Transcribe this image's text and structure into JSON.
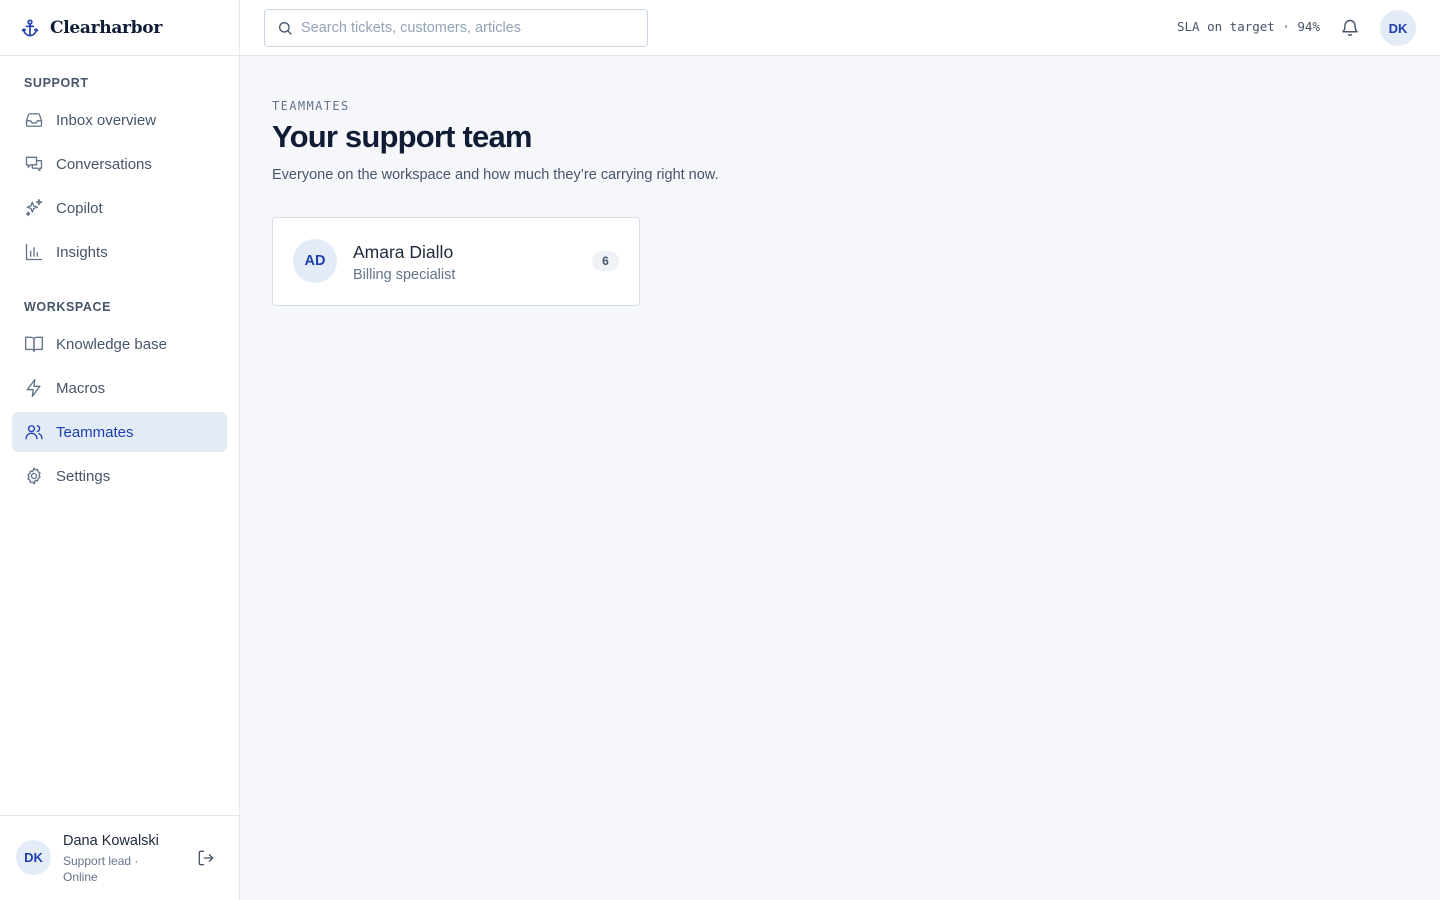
{
  "brand": {
    "name": "Clearharbor"
  },
  "sidebar": {
    "sections": [
      {
        "label": "SUPPORT"
      },
      {
        "label": "WORKSPACE"
      }
    ],
    "items": [
      {
        "label": "Inbox overview",
        "icon": "inbox-icon"
      },
      {
        "label": "Conversations",
        "icon": "chat-bubbles-icon"
      },
      {
        "label": "Copilot",
        "icon": "sparkles-icon"
      },
      {
        "label": "Insights",
        "icon": "bar-chart-icon"
      },
      {
        "label": "Knowledge base",
        "icon": "book-open-icon"
      },
      {
        "label": "Macros",
        "icon": "lightning-icon"
      },
      {
        "label": "Teammates",
        "icon": "users-icon",
        "active": true
      },
      {
        "label": "Settings",
        "icon": "gear-icon"
      }
    ],
    "user": {
      "initials": "DK",
      "name": "Dana Kowalski",
      "role": "Support lead · Online"
    }
  },
  "topbar": {
    "search": {
      "placeholder": "Search tickets, customers, articles",
      "value": ""
    },
    "sla": "SLA on target · 94%",
    "avatar_initials": "DK"
  },
  "main": {
    "eyebrow": "TEAMMATES",
    "title": "Your support team",
    "subtitle": "Everyone on the workspace and how much they’re carrying right now.",
    "teammates": [
      {
        "initials": "AD",
        "name": "Amara Diallo",
        "role": "Billing specialist",
        "count": "6"
      }
    ]
  },
  "colors": {
    "accent": "#1e40af",
    "active_bg": "#e3ebf6",
    "background": "#f5f7fb"
  }
}
